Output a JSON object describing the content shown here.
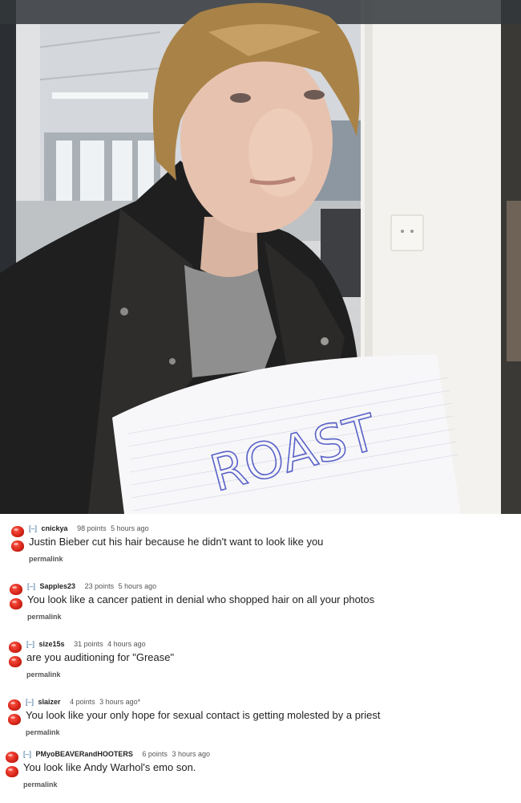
{
  "photo": {
    "sign_text": "ROAST"
  },
  "comments": [
    {
      "collapse": "[–]",
      "author": "cnickya",
      "score": "98 points",
      "time": "5 hours ago",
      "body": "Justin Bieber cut his hair because he didn't want to look like you",
      "permalink": "permalink"
    },
    {
      "collapse": "[–]",
      "author": "Sapples23",
      "score": "23 points",
      "time": "5 hours ago",
      "body": "You look like a cancer patient in denial who shopped hair on all your photos",
      "permalink": "permalink"
    },
    {
      "collapse": "[–]",
      "author": "size15s",
      "score": "31 points",
      "time": "4 hours ago",
      "body": "are you auditioning for \"Grease\"",
      "permalink": "permalink"
    },
    {
      "collapse": "[–]",
      "author": "slaizer",
      "score": "4 points",
      "time": "3 hours ago*",
      "body": "You look like your only hope for sexual contact is getting molested by a priest",
      "permalink": "permalink"
    },
    {
      "collapse": "[–]",
      "author": "PMyoBEAVERandHOOTERS",
      "score": "6 points",
      "time": "3 hours ago",
      "body": "You look like Andy Warhol's emo son.",
      "permalink": "permalink"
    }
  ]
}
